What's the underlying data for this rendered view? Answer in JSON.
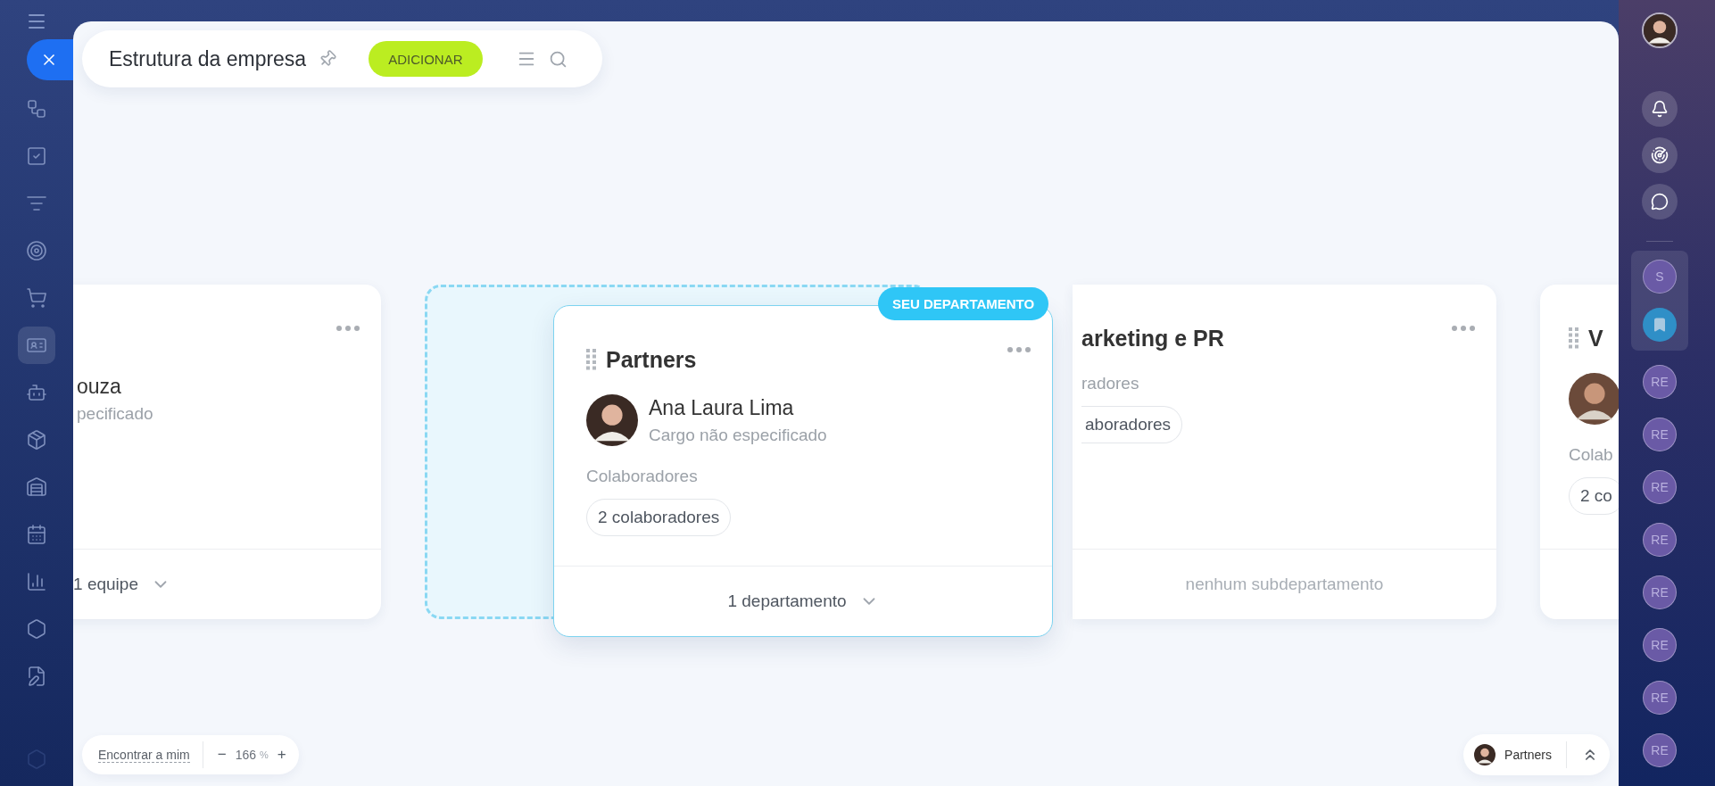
{
  "left_rail": {
    "items": [
      {
        "selected": false
      },
      {
        "selected": false
      },
      {
        "selected": false
      },
      {
        "selected": false
      },
      {
        "selected": false
      },
      {
        "selected": true
      },
      {
        "selected": false
      },
      {
        "selected": false
      },
      {
        "selected": false
      },
      {
        "selected": false
      },
      {
        "selected": false
      },
      {
        "selected": false
      },
      {
        "selected": false
      },
      {
        "selected": false
      }
    ]
  },
  "toolbar": {
    "title": "Estrutura da empresa",
    "add_button": "ADICIONAR"
  },
  "departments": [
    {
      "head_name": "ouza",
      "head_role": "pecificado",
      "photo": false,
      "menu": true,
      "handle": false,
      "footer": "1 equipe",
      "footer_chevron": true
    },
    {
      "title": "arketing e PR",
      "employees_label": "radores",
      "employees_count": "aboradores",
      "menu": true,
      "handle": false,
      "footer": "nenhum subdepartamento",
      "footer_chevron": false
    },
    {
      "title": "V",
      "photo": true,
      "employees_label": "Colab",
      "employees_count": "2 co",
      "menu": false,
      "handle": true
    }
  ],
  "dragged_department": {
    "title": "Partners",
    "badge": "SEU DEPARTAMENTO",
    "head_name": "Ana Laura Lima",
    "head_role": "Cargo não especificado",
    "photo": true,
    "employees_label": "Colaboradores",
    "employees_count": "2 colaboradores",
    "menu": true,
    "handle": true,
    "footer": "1 departamento",
    "footer_chevron": true
  },
  "zoom_bar": {
    "find_me": "Encontrar a mim",
    "minus": "−",
    "value": "166",
    "unit": "%",
    "plus": "+"
  },
  "current_department": {
    "name": "Partners"
  },
  "right_rail": {
    "pinned": [
      {
        "initials": "S",
        "kind": "initials"
      },
      {
        "kind": "bookmark"
      }
    ],
    "chats": [
      {
        "initials": "RE"
      },
      {
        "initials": "RE"
      },
      {
        "initials": "RE"
      },
      {
        "initials": "RE"
      },
      {
        "initials": "RE"
      },
      {
        "initials": "RE"
      },
      {
        "initials": "RE"
      },
      {
        "initials": "RE"
      }
    ]
  }
}
